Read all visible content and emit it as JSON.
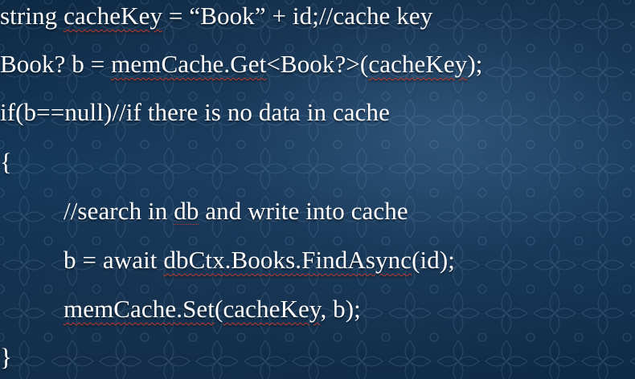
{
  "code": {
    "line1": {
      "p1": "string ",
      "w1": "cacheKey",
      "p2": " = “Book” + id;//cache key"
    },
    "line2": {
      "p1": "Book? b = ",
      "w1": "memCache.Get",
      "p2": "<Book?>(",
      "w2": "cacheKey",
      "p3": ");"
    },
    "line3": {
      "text": "if(b==null)//if there is no data in cache"
    },
    "line4": {
      "text": "{"
    },
    "line5": {
      "p1": "//search in ",
      "w1": "db",
      "p2": " and write into cache"
    },
    "line6": {
      "p1": "b = await ",
      "w1": "dbCtx.Books.FindAsync",
      "p2": "(id);"
    },
    "line7": {
      "w1": "memCache.Set",
      "p1": "(",
      "w2": "cacheKey",
      "p2": ", b);"
    },
    "line8": {
      "text": "}"
    }
  },
  "colors": {
    "background": "#0f2a44",
    "text": "#ffffff",
    "spellcheck_underline": "#c0392b"
  }
}
